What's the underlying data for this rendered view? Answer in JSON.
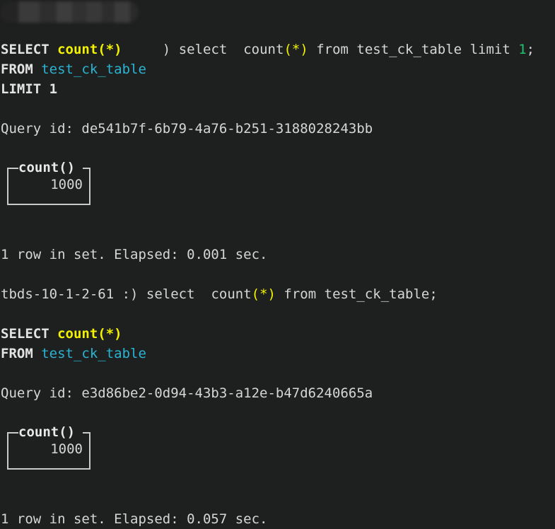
{
  "terminal": {
    "background_color": "#1e1f1f",
    "foreground_color": "#d6d6d6",
    "accent_colors": {
      "keyword": "#e3e3e3",
      "function": "#f2f200",
      "identifier": "#2ab4d4",
      "number": "#1fc56b",
      "border": "#c9c9c9"
    }
  },
  "session": {
    "blocks": [
      {
        "prompt": {
          "hostname_redacted": true,
          "prompt_visible_suffix": ")",
          "command_keyword": "select",
          "command_gap": "  ",
          "command_function_name": "count",
          "command_function_parens": "(*)",
          "command_from": " from ",
          "command_table": "test_ck_table",
          "command_limit_keyword": " limit ",
          "command_limit_value": "1",
          "command_terminator": ";"
        },
        "echo": [
          {
            "keyword": "SELECT",
            "space": " ",
            "func": "count(*)"
          },
          {
            "keyword": "FROM",
            "space": " ",
            "ident": "test_ck_table"
          },
          {
            "keyword": "LIMIT 1"
          }
        ],
        "query_id_label": "Query id: ",
        "query_id_value": "de541b7f-6b79-4a76-b251-3188028243bb",
        "result": {
          "column_header": "count()",
          "value": "1000"
        },
        "status": "1 row in set. Elapsed: 0.001 sec."
      },
      {
        "prompt": {
          "hostname_redacted": false,
          "hostname": "tbds-10-1-2-61",
          "prompt_symbol": " :) ",
          "command_keyword": "select",
          "command_gap": "  ",
          "command_function_name": "count",
          "command_function_parens": "(*)",
          "command_from": " from ",
          "command_table": "test_ck_table",
          "command_terminator": ";"
        },
        "echo": [
          {
            "keyword": "SELECT",
            "space": " ",
            "func": "count(*)"
          },
          {
            "keyword": "FROM",
            "space": " ",
            "ident": "test_ck_table"
          }
        ],
        "query_id_label": "Query id: ",
        "query_id_value": "e3d86be2-0d94-43b3-a12e-b47d6240665a",
        "result": {
          "column_header": "count()",
          "value": "1000"
        },
        "status": "1 row in set. Elapsed: 0.057 sec."
      }
    ]
  }
}
